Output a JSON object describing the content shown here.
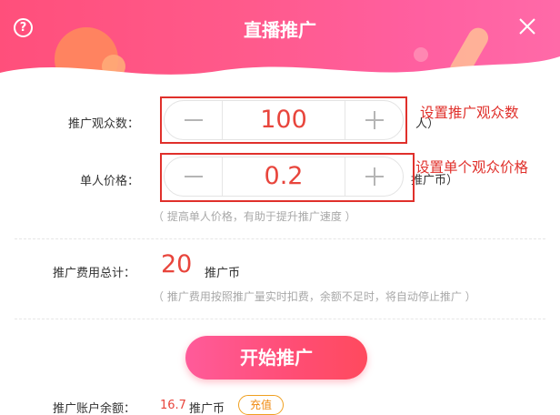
{
  "header": {
    "title": "直播推广",
    "help_icon": "question-circle-icon",
    "close_icon": "close-x-icon",
    "gradient_colors": [
      "#ff4f7b",
      "#ff6aa8"
    ]
  },
  "audience": {
    "label": "推广观众数：",
    "value": "100",
    "unit": "人）",
    "annotation": "设置推广观众数"
  },
  "price": {
    "label": "单人价格：",
    "value": "0.2",
    "unit": "推广币）",
    "hint": "（ 提高单人价格，有助于提升推广速度 ）",
    "annotation": "设置单个观众价格"
  },
  "total": {
    "label": "推广费用总计：",
    "value": "20",
    "unit": "推广币",
    "hint": "（ 推广费用按照推广量实时扣费，余额不足时，将自动停止推广 ）"
  },
  "start_button": {
    "label": "开始推广"
  },
  "balance": {
    "label": "推广账户余额：",
    "value": "16.7",
    "unit": "推广币",
    "recharge_label": "充值"
  },
  "colors": {
    "accent": "#e8453c",
    "annotation": "#e0302b",
    "recharge": "#f08a10"
  }
}
